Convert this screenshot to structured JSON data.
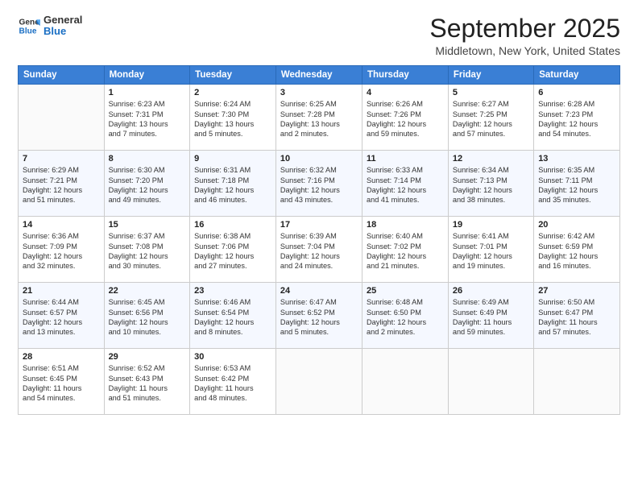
{
  "header": {
    "logo_line1": "General",
    "logo_line2": "Blue",
    "title": "September 2025",
    "subtitle": "Middletown, New York, United States"
  },
  "days_of_week": [
    "Sunday",
    "Monday",
    "Tuesday",
    "Wednesday",
    "Thursday",
    "Friday",
    "Saturday"
  ],
  "weeks": [
    [
      {
        "day": "",
        "detail": ""
      },
      {
        "day": "1",
        "detail": "Sunrise: 6:23 AM\nSunset: 7:31 PM\nDaylight: 13 hours\nand 7 minutes."
      },
      {
        "day": "2",
        "detail": "Sunrise: 6:24 AM\nSunset: 7:30 PM\nDaylight: 13 hours\nand 5 minutes."
      },
      {
        "day": "3",
        "detail": "Sunrise: 6:25 AM\nSunset: 7:28 PM\nDaylight: 13 hours\nand 2 minutes."
      },
      {
        "day": "4",
        "detail": "Sunrise: 6:26 AM\nSunset: 7:26 PM\nDaylight: 12 hours\nand 59 minutes."
      },
      {
        "day": "5",
        "detail": "Sunrise: 6:27 AM\nSunset: 7:25 PM\nDaylight: 12 hours\nand 57 minutes."
      },
      {
        "day": "6",
        "detail": "Sunrise: 6:28 AM\nSunset: 7:23 PM\nDaylight: 12 hours\nand 54 minutes."
      }
    ],
    [
      {
        "day": "7",
        "detail": "Sunrise: 6:29 AM\nSunset: 7:21 PM\nDaylight: 12 hours\nand 51 minutes."
      },
      {
        "day": "8",
        "detail": "Sunrise: 6:30 AM\nSunset: 7:20 PM\nDaylight: 12 hours\nand 49 minutes."
      },
      {
        "day": "9",
        "detail": "Sunrise: 6:31 AM\nSunset: 7:18 PM\nDaylight: 12 hours\nand 46 minutes."
      },
      {
        "day": "10",
        "detail": "Sunrise: 6:32 AM\nSunset: 7:16 PM\nDaylight: 12 hours\nand 43 minutes."
      },
      {
        "day": "11",
        "detail": "Sunrise: 6:33 AM\nSunset: 7:14 PM\nDaylight: 12 hours\nand 41 minutes."
      },
      {
        "day": "12",
        "detail": "Sunrise: 6:34 AM\nSunset: 7:13 PM\nDaylight: 12 hours\nand 38 minutes."
      },
      {
        "day": "13",
        "detail": "Sunrise: 6:35 AM\nSunset: 7:11 PM\nDaylight: 12 hours\nand 35 minutes."
      }
    ],
    [
      {
        "day": "14",
        "detail": "Sunrise: 6:36 AM\nSunset: 7:09 PM\nDaylight: 12 hours\nand 32 minutes."
      },
      {
        "day": "15",
        "detail": "Sunrise: 6:37 AM\nSunset: 7:08 PM\nDaylight: 12 hours\nand 30 minutes."
      },
      {
        "day": "16",
        "detail": "Sunrise: 6:38 AM\nSunset: 7:06 PM\nDaylight: 12 hours\nand 27 minutes."
      },
      {
        "day": "17",
        "detail": "Sunrise: 6:39 AM\nSunset: 7:04 PM\nDaylight: 12 hours\nand 24 minutes."
      },
      {
        "day": "18",
        "detail": "Sunrise: 6:40 AM\nSunset: 7:02 PM\nDaylight: 12 hours\nand 21 minutes."
      },
      {
        "day": "19",
        "detail": "Sunrise: 6:41 AM\nSunset: 7:01 PM\nDaylight: 12 hours\nand 19 minutes."
      },
      {
        "day": "20",
        "detail": "Sunrise: 6:42 AM\nSunset: 6:59 PM\nDaylight: 12 hours\nand 16 minutes."
      }
    ],
    [
      {
        "day": "21",
        "detail": "Sunrise: 6:44 AM\nSunset: 6:57 PM\nDaylight: 12 hours\nand 13 minutes."
      },
      {
        "day": "22",
        "detail": "Sunrise: 6:45 AM\nSunset: 6:56 PM\nDaylight: 12 hours\nand 10 minutes."
      },
      {
        "day": "23",
        "detail": "Sunrise: 6:46 AM\nSunset: 6:54 PM\nDaylight: 12 hours\nand 8 minutes."
      },
      {
        "day": "24",
        "detail": "Sunrise: 6:47 AM\nSunset: 6:52 PM\nDaylight: 12 hours\nand 5 minutes."
      },
      {
        "day": "25",
        "detail": "Sunrise: 6:48 AM\nSunset: 6:50 PM\nDaylight: 12 hours\nand 2 minutes."
      },
      {
        "day": "26",
        "detail": "Sunrise: 6:49 AM\nSunset: 6:49 PM\nDaylight: 11 hours\nand 59 minutes."
      },
      {
        "day": "27",
        "detail": "Sunrise: 6:50 AM\nSunset: 6:47 PM\nDaylight: 11 hours\nand 57 minutes."
      }
    ],
    [
      {
        "day": "28",
        "detail": "Sunrise: 6:51 AM\nSunset: 6:45 PM\nDaylight: 11 hours\nand 54 minutes."
      },
      {
        "day": "29",
        "detail": "Sunrise: 6:52 AM\nSunset: 6:43 PM\nDaylight: 11 hours\nand 51 minutes."
      },
      {
        "day": "30",
        "detail": "Sunrise: 6:53 AM\nSunset: 6:42 PM\nDaylight: 11 hours\nand 48 minutes."
      },
      {
        "day": "",
        "detail": ""
      },
      {
        "day": "",
        "detail": ""
      },
      {
        "day": "",
        "detail": ""
      },
      {
        "day": "",
        "detail": ""
      }
    ]
  ]
}
